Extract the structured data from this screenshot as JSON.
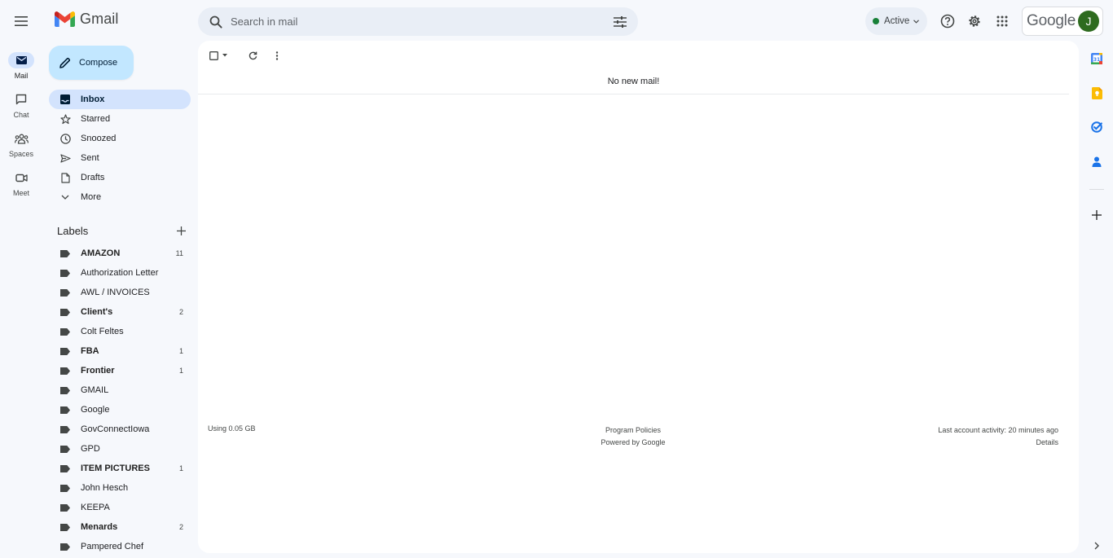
{
  "app": {
    "name": "Gmail"
  },
  "search": {
    "placeholder": "Search in mail"
  },
  "status": {
    "label": "Active",
    "color": "#188038"
  },
  "account": {
    "brand": "Google",
    "avatar_initial": "J",
    "avatar_color": "#2e6b1f"
  },
  "rail": {
    "items": [
      {
        "label": "Mail",
        "icon": "mail-icon",
        "active": true
      },
      {
        "label": "Chat",
        "icon": "chat-icon",
        "active": false
      },
      {
        "label": "Spaces",
        "icon": "spaces-icon",
        "active": false
      },
      {
        "label": "Meet",
        "icon": "meet-icon",
        "active": false
      }
    ]
  },
  "compose": {
    "label": "Compose"
  },
  "nav": {
    "items": [
      {
        "label": "Inbox",
        "icon": "inbox-icon",
        "active": true
      },
      {
        "label": "Starred",
        "icon": "star-icon"
      },
      {
        "label": "Snoozed",
        "icon": "clock-icon"
      },
      {
        "label": "Sent",
        "icon": "send-icon"
      },
      {
        "label": "Drafts",
        "icon": "draft-icon"
      },
      {
        "label": "More",
        "icon": "chevron-down-icon"
      }
    ]
  },
  "labels": {
    "title": "Labels",
    "items": [
      {
        "name": "AMAZON",
        "count": "11",
        "bold": true
      },
      {
        "name": "Authorization Letter",
        "count": "",
        "bold": false
      },
      {
        "name": "AWL / INVOICES",
        "count": "",
        "bold": false
      },
      {
        "name": "Client's",
        "count": "2",
        "bold": true
      },
      {
        "name": "Colt Feltes",
        "count": "",
        "bold": false
      },
      {
        "name": "FBA",
        "count": "1",
        "bold": true
      },
      {
        "name": "Frontier",
        "count": "1",
        "bold": true
      },
      {
        "name": "GMAIL",
        "count": "",
        "bold": false
      },
      {
        "name": "Google",
        "count": "",
        "bold": false
      },
      {
        "name": "GovConnectIowa",
        "count": "",
        "bold": false
      },
      {
        "name": "GPD",
        "count": "",
        "bold": false
      },
      {
        "name": "ITEM PICTURES",
        "count": "1",
        "bold": true
      },
      {
        "name": "John Hesch",
        "count": "",
        "bold": false
      },
      {
        "name": "KEEPA",
        "count": "",
        "bold": false
      },
      {
        "name": "Menards",
        "count": "2",
        "bold": true
      },
      {
        "name": "Pampered Chef",
        "count": "",
        "bold": false
      }
    ]
  },
  "main": {
    "empty_message": "No new mail!",
    "footer": {
      "storage": "Using 0.05 GB",
      "policies": "Program Policies",
      "powered": "Powered by Google",
      "activity": "Last account activity: 20 minutes ago",
      "details": "Details"
    }
  },
  "side_panel": {
    "items": [
      "calendar-icon",
      "keep-icon",
      "tasks-icon",
      "contacts-icon",
      "add-icon"
    ]
  }
}
